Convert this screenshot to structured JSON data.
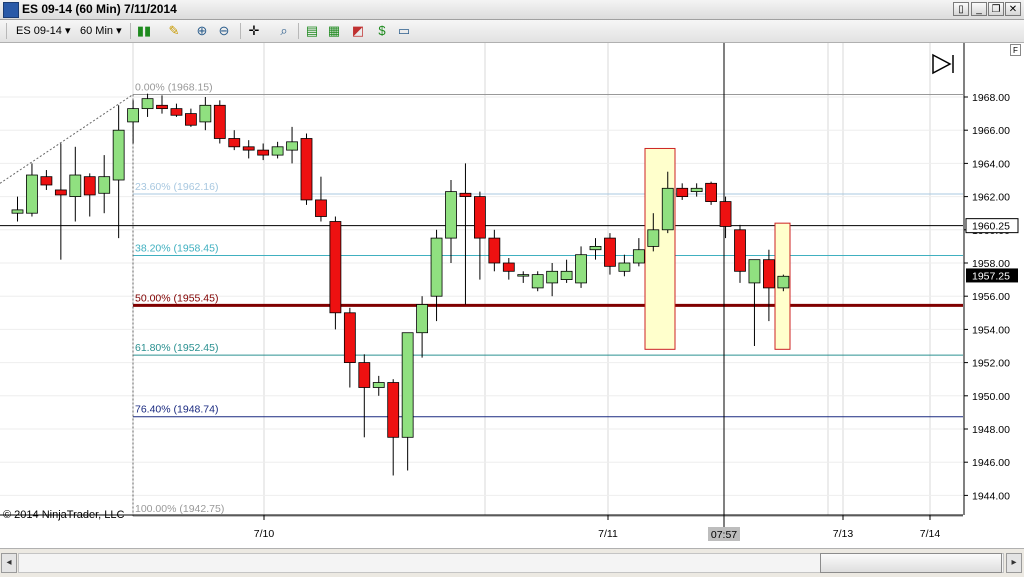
{
  "window": {
    "title": "ES 09-14 (60 Min)  7/11/2014",
    "minimize_label": "_",
    "restore_label": "❐",
    "close_label": "✕",
    "extra_label": "▯"
  },
  "toolbar": {
    "instrument": "ES 09-14",
    "interval": "60 Min",
    "dropdown_arrow": "▾"
  },
  "chart": {
    "copyright": "© 2014 NinjaTrader, LLC",
    "fib_button": "F",
    "crosshair_time": "07:57",
    "crosshair_price_label": "1960.25",
    "last_price_label": "1957.25",
    "colors": {
      "up": "#90e080",
      "down": "#ee1111",
      "highlight_fill": "#ffffcc",
      "highlight_stroke": "#cc2222"
    }
  },
  "chart_data": {
    "type": "candlestick",
    "y_range": [
      1942.5,
      1970.0
    ],
    "y_ticks": [
      "1968.00",
      "1966.00",
      "1964.00",
      "1962.00",
      "1960.00",
      "1958.00",
      "1956.00",
      "1954.00",
      "1952.00",
      "1950.00",
      "1948.00",
      "1946.00",
      "1944.00"
    ],
    "x_labels": [
      "7/10",
      "7/11",
      "7/13",
      "7/14"
    ],
    "fib_levels": [
      {
        "label": "0.00% (1968.15)",
        "price": 1968.15,
        "color": "#999999"
      },
      {
        "label": "23.60% (1962.16)",
        "price": 1962.16,
        "color": "#a8c8e0"
      },
      {
        "label": "38.20% (1958.45)",
        "price": 1958.45,
        "color": "#40b0c0"
      },
      {
        "label": "50.00% (1955.45)",
        "price": 1955.45,
        "color": "#800000"
      },
      {
        "label": "61.80% (1952.45)",
        "price": 1952.45,
        "color": "#2a9090"
      },
      {
        "label": "76.40% (1948.74)",
        "price": 1948.74,
        "color": "#1a2a80"
      },
      {
        "label": "100.00% (1942.75)",
        "price": 1942.75,
        "color": "#999999"
      }
    ],
    "crosshair_price": 1960.25,
    "last_price": 1957.25,
    "candles": [
      {
        "o": 1961.0,
        "h": 1962.0,
        "l": 1960.5,
        "c": 1961.2
      },
      {
        "o": 1961.0,
        "h": 1964.0,
        "l": 1960.8,
        "c": 1963.3
      },
      {
        "o": 1963.2,
        "h": 1963.6,
        "l": 1962.4,
        "c": 1962.7
      },
      {
        "o": 1962.4,
        "h": 1965.2,
        "l": 1958.2,
        "c": 1962.1
      },
      {
        "o": 1962.0,
        "h": 1965.0,
        "l": 1960.5,
        "c": 1963.3
      },
      {
        "o": 1963.2,
        "h": 1963.4,
        "l": 1960.8,
        "c": 1962.1
      },
      {
        "o": 1962.2,
        "h": 1964.5,
        "l": 1961.0,
        "c": 1963.2
      },
      {
        "o": 1963.0,
        "h": 1967.5,
        "l": 1959.5,
        "c": 1966.0
      },
      {
        "o": 1966.5,
        "h": 1967.8,
        "l": 1965.2,
        "c": 1967.3
      },
      {
        "o": 1967.3,
        "h": 1968.2,
        "l": 1966.8,
        "c": 1967.9
      },
      {
        "o": 1967.5,
        "h": 1968.1,
        "l": 1967.0,
        "c": 1967.3
      },
      {
        "o": 1967.3,
        "h": 1967.6,
        "l": 1966.8,
        "c": 1966.9
      },
      {
        "o": 1967.0,
        "h": 1967.3,
        "l": 1966.2,
        "c": 1966.3
      },
      {
        "o": 1966.5,
        "h": 1968.0,
        "l": 1966.0,
        "c": 1967.5
      },
      {
        "o": 1967.5,
        "h": 1967.8,
        "l": 1965.2,
        "c": 1965.5
      },
      {
        "o": 1965.5,
        "h": 1966.0,
        "l": 1964.8,
        "c": 1965.0
      },
      {
        "o": 1965.0,
        "h": 1965.4,
        "l": 1964.3,
        "c": 1964.8
      },
      {
        "o": 1964.8,
        "h": 1965.2,
        "l": 1964.2,
        "c": 1964.5
      },
      {
        "o": 1964.5,
        "h": 1965.3,
        "l": 1964.3,
        "c": 1965.0
      },
      {
        "o": 1964.8,
        "h": 1966.2,
        "l": 1964.0,
        "c": 1965.3
      },
      {
        "o": 1965.5,
        "h": 1965.8,
        "l": 1961.5,
        "c": 1961.8
      },
      {
        "o": 1961.8,
        "h": 1963.2,
        "l": 1960.5,
        "c": 1960.8
      },
      {
        "o": 1960.5,
        "h": 1960.8,
        "l": 1954.0,
        "c": 1955.0
      },
      {
        "o": 1955.0,
        "h": 1955.3,
        "l": 1950.5,
        "c": 1952.0
      },
      {
        "o": 1952.0,
        "h": 1952.5,
        "l": 1947.5,
        "c": 1950.5
      },
      {
        "o": 1950.5,
        "h": 1951.2,
        "l": 1950.0,
        "c": 1950.8
      },
      {
        "o": 1950.8,
        "h": 1951.0,
        "l": 1945.2,
        "c": 1947.5
      },
      {
        "o": 1947.5,
        "h": 1951.5,
        "l": 1945.5,
        "c": 1953.8
      },
      {
        "o": 1953.8,
        "h": 1956.0,
        "l": 1952.3,
        "c": 1955.5
      },
      {
        "o": 1956.0,
        "h": 1960.0,
        "l": 1954.5,
        "c": 1959.5
      },
      {
        "o": 1959.5,
        "h": 1963.0,
        "l": 1958.0,
        "c": 1962.3
      },
      {
        "o": 1962.2,
        "h": 1964.0,
        "l": 1955.5,
        "c": 1962.0
      },
      {
        "o": 1962.0,
        "h": 1962.3,
        "l": 1957.0,
        "c": 1959.5
      },
      {
        "o": 1959.5,
        "h": 1960.0,
        "l": 1957.5,
        "c": 1958.0
      },
      {
        "o": 1958.0,
        "h": 1958.3,
        "l": 1957.0,
        "c": 1957.5
      },
      {
        "o": 1957.3,
        "h": 1957.5,
        "l": 1956.8,
        "c": 1957.3
      },
      {
        "o": 1956.5,
        "h": 1957.5,
        "l": 1956.3,
        "c": 1957.3
      },
      {
        "o": 1956.8,
        "h": 1958.0,
        "l": 1956.0,
        "c": 1957.5
      },
      {
        "o": 1957.0,
        "h": 1958.2,
        "l": 1956.8,
        "c": 1957.5
      },
      {
        "o": 1956.8,
        "h": 1959.0,
        "l": 1956.5,
        "c": 1958.5
      },
      {
        "o": 1958.8,
        "h": 1959.5,
        "l": 1958.2,
        "c": 1959.0
      },
      {
        "o": 1959.5,
        "h": 1959.8,
        "l": 1957.3,
        "c": 1957.8
      },
      {
        "o": 1957.5,
        "h": 1958.5,
        "l": 1957.2,
        "c": 1958.0
      },
      {
        "o": 1958.0,
        "h": 1959.5,
        "l": 1957.8,
        "c": 1958.8
      },
      {
        "o": 1959.0,
        "h": 1961.0,
        "l": 1958.7,
        "c": 1960.0
      },
      {
        "o": 1960.0,
        "h": 1963.5,
        "l": 1959.8,
        "c": 1962.5
      },
      {
        "o": 1962.5,
        "h": 1962.8,
        "l": 1961.8,
        "c": 1962.0
      },
      {
        "o": 1962.3,
        "h": 1962.8,
        "l": 1962.0,
        "c": 1962.5
      },
      {
        "o": 1962.8,
        "h": 1962.9,
        "l": 1961.5,
        "c": 1961.7
      },
      {
        "o": 1961.7,
        "h": 1962.0,
        "l": 1959.5,
        "c": 1960.2
      },
      {
        "o": 1960.0,
        "h": 1960.3,
        "l": 1956.8,
        "c": 1957.5
      },
      {
        "o": 1956.8,
        "h": 1958.2,
        "l": 1953.0,
        "c": 1958.2
      },
      {
        "o": 1958.2,
        "h": 1958.8,
        "l": 1954.5,
        "c": 1956.5
      },
      {
        "o": 1956.5,
        "h": 1957.3,
        "l": 1956.3,
        "c": 1957.2
      }
    ]
  }
}
